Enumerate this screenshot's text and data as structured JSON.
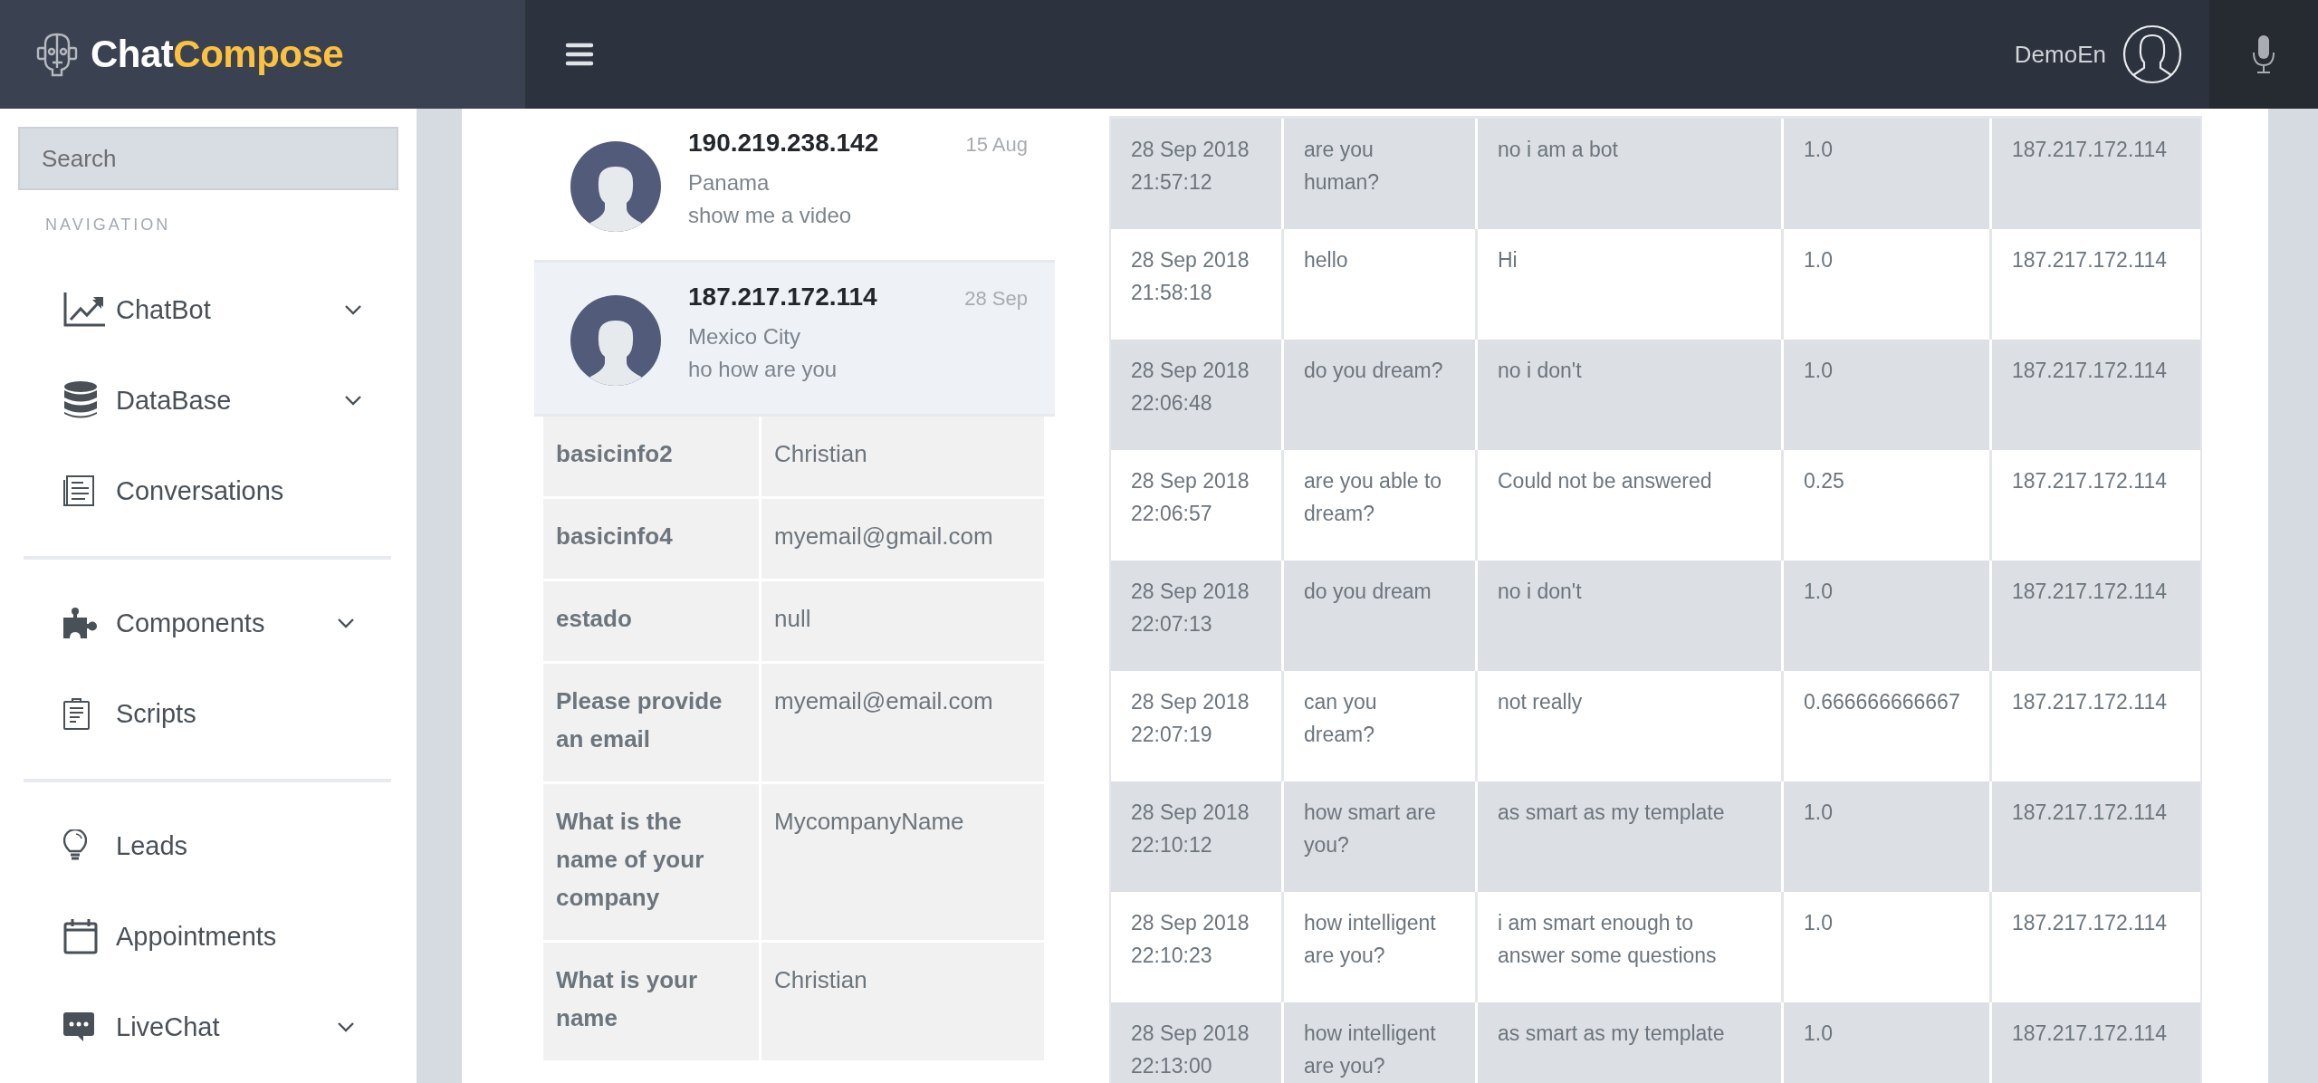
{
  "brand": {
    "first": "Chat",
    "second": "Compose"
  },
  "topbar": {
    "user": "DemoEn"
  },
  "sidebar": {
    "search": {
      "placeholder": "Search"
    },
    "section": "NAVIGATION",
    "groups": [
      [
        {
          "label": "ChatBot",
          "has_submenu": true
        },
        {
          "label": "DataBase",
          "has_submenu": true
        },
        {
          "label": "Conversations",
          "has_submenu": false
        }
      ],
      [
        {
          "label": "Components",
          "has_submenu": true
        },
        {
          "label": "Scripts",
          "has_submenu": false
        }
      ],
      [
        {
          "label": "Leads",
          "has_submenu": false
        },
        {
          "label": "Appointments",
          "has_submenu": false
        },
        {
          "label": "LiveChat",
          "has_submenu": true
        }
      ]
    ]
  },
  "conversations": [
    {
      "title": "190.219.238.142",
      "date": "15 Aug",
      "location": "Panama",
      "last_message": "show me a video",
      "selected": false
    },
    {
      "title": "187.217.172.114",
      "date": "28 Sep",
      "location": "Mexico City",
      "last_message": "ho how are you",
      "selected": true
    }
  ],
  "contact_info": [
    {
      "field": "basicinfo2",
      "value": "Christian"
    },
    {
      "field": "basicinfo4",
      "value": "myemail@gmail.com"
    },
    {
      "field": "estado",
      "value": "null"
    },
    {
      "field": "Please provide\nan email",
      "value": "myemail@email.com"
    },
    {
      "field": "What is the\nname of your\ncompany",
      "value": "MycompanyName"
    },
    {
      "field": "What is your\nname",
      "value": "Christian"
    }
  ],
  "messages": {
    "rows": [
      [
        "28 Sep 2018\n21:57:12",
        "are you\nhuman?",
        "no i am a bot",
        "1.0",
        "187.217.172.114"
      ],
      [
        "28 Sep 2018\n21:58:18",
        "hello",
        "Hi",
        "1.0",
        "187.217.172.114"
      ],
      [
        "28 Sep 2018\n22:06:48",
        "do you dream?",
        "no i don't",
        "1.0",
        "187.217.172.114"
      ],
      [
        "28 Sep 2018\n22:06:57",
        "are you able to\ndream?",
        "Could not be answered",
        "0.25",
        "187.217.172.114"
      ],
      [
        "28 Sep 2018\n22:07:13",
        "do you dream",
        "no i don't",
        "1.0",
        "187.217.172.114"
      ],
      [
        "28 Sep 2018\n22:07:19",
        "can you\ndream?",
        "not really",
        "0.666666666667",
        "187.217.172.114"
      ],
      [
        "28 Sep 2018\n22:10:12",
        "how smart are\nyou?",
        "as smart as my template",
        "1.0",
        "187.217.172.114"
      ],
      [
        "28 Sep 2018\n22:10:23",
        "how intelligent\nare you?",
        "i am smart enough to\nanswer some questions",
        "1.0",
        "187.217.172.114"
      ],
      [
        "28 Sep 2018\n22:13:00",
        "how intelligent\nare you?",
        "as smart as my template",
        "1.0",
        "187.217.172.114"
      ]
    ]
  }
}
